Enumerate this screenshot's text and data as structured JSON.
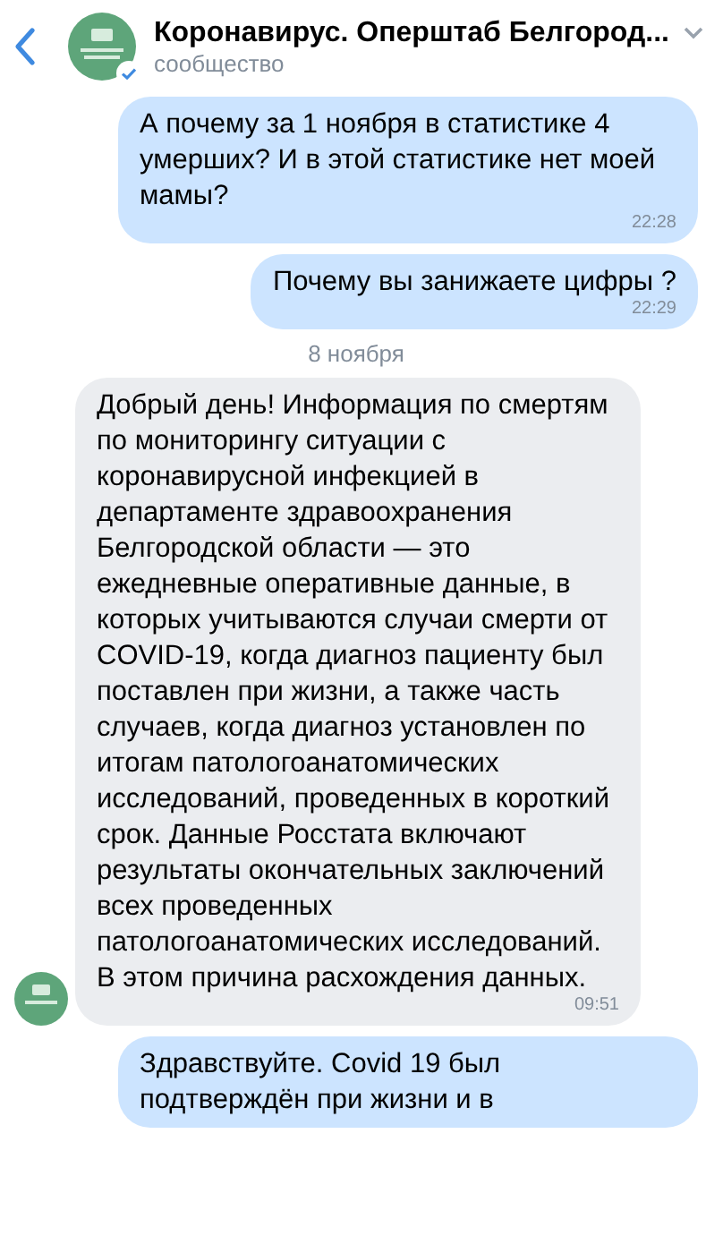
{
  "header": {
    "title": "Коронавирус. Оперштаб Белгород...",
    "subtitle": "сообщество",
    "verified": true
  },
  "messages": [
    {
      "kind": "outgoing",
      "text": "А почему за 1 ноября в статистике 4 умерших? И в этой статистике нет моей мамы?",
      "time": "22:28"
    },
    {
      "kind": "outgoing",
      "text": "Почему вы занижаете цифры ?",
      "time": "22:29"
    },
    {
      "kind": "date",
      "text": "8 ноября"
    },
    {
      "kind": "incoming",
      "text": "Добрый день! Информация по смертям по мониторингу ситуации с коронавирусной инфекцией в департаменте здравоохранения Белгородской области — это ежедневные оперативные данные, в которых учитываются случаи смерти от COVID-19, когда диагноз пациенту был поставлен при жизни, а также часть случаев, когда диагноз установлен по итогам патологоанатомических исследований, проведенных в короткий срок. Данные Росстата включают результаты окончательных заключений всех проведенных патологоанатомических исследований. В этом причина расхождения данных.",
      "time": "09:51"
    },
    {
      "kind": "outgoing",
      "text": "Здравствуйте. Covid 19 был подтверждён при жизни и в"
    }
  ]
}
